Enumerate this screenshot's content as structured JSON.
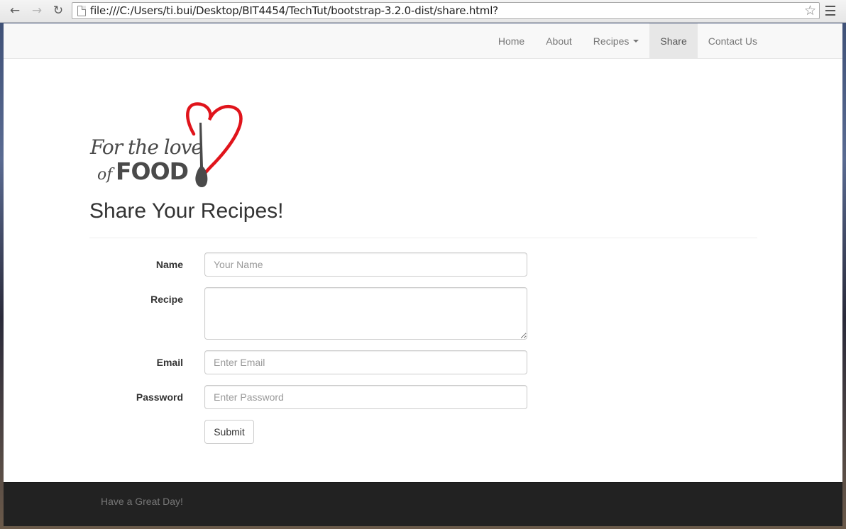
{
  "browser": {
    "url": "file:///C:/Users/ti.bui/Desktop/BIT4454/TechTut/bootstrap-3.2.0-dist/share.html?",
    "back_icon": "back-arrow-icon",
    "forward_icon": "forward-arrow-icon",
    "reload_icon": "reload-icon",
    "bookmark_icon": "star-icon",
    "menu_icon": "hamburger-menu-icon"
  },
  "navbar": {
    "items": [
      {
        "label": "Home"
      },
      {
        "label": "About"
      },
      {
        "label": "Recipes",
        "dropdown": true
      },
      {
        "label": "Share",
        "active": true
      },
      {
        "label": "Contact Us"
      }
    ]
  },
  "logo": {
    "line1": "For the love",
    "line2_prefix": "of",
    "line2_main": "FOOD",
    "heart_color": "#e0141b",
    "text_color": "#4a4a4a"
  },
  "page": {
    "title": "Share Your Recipes!"
  },
  "form": {
    "name_label": "Name",
    "name_placeholder": "Your Name",
    "recipe_label": "Recipe",
    "recipe_value": "",
    "email_label": "Email",
    "email_placeholder": "Enter Email",
    "password_label": "Password",
    "password_placeholder": "Enter Password",
    "submit_label": "Submit"
  },
  "footer": {
    "text": "Have a Great Day!"
  }
}
